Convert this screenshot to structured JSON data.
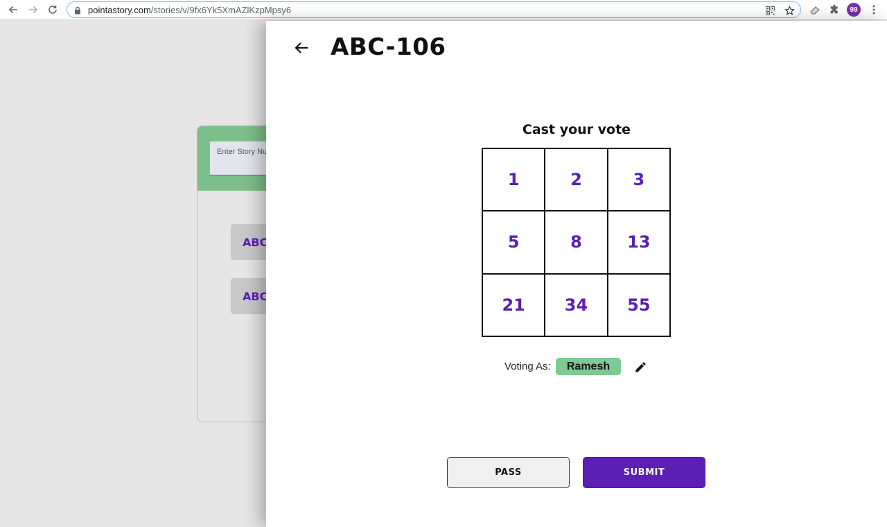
{
  "browser": {
    "url_host": "pointastory.com",
    "url_path": "/stories/v/9fx6Yk5XmAZlKzpMpsy6",
    "profile_initials": "99"
  },
  "background": {
    "input_placeholder": "Enter Story Nu",
    "stories": [
      "ABC-",
      "ABC-"
    ]
  },
  "drawer": {
    "story_title": "ABC-106",
    "vote_heading": "Cast your vote",
    "vote_options": [
      "1",
      "2",
      "3",
      "5",
      "8",
      "13",
      "21",
      "34",
      "55"
    ],
    "voting_as_label": "Voting As:",
    "voter_name": "Ramesh",
    "pass_label": "PASS",
    "submit_label": "SUBMIT"
  },
  "colors": {
    "accent_purple": "#5b1fb4",
    "accent_green": "#7dca92"
  }
}
